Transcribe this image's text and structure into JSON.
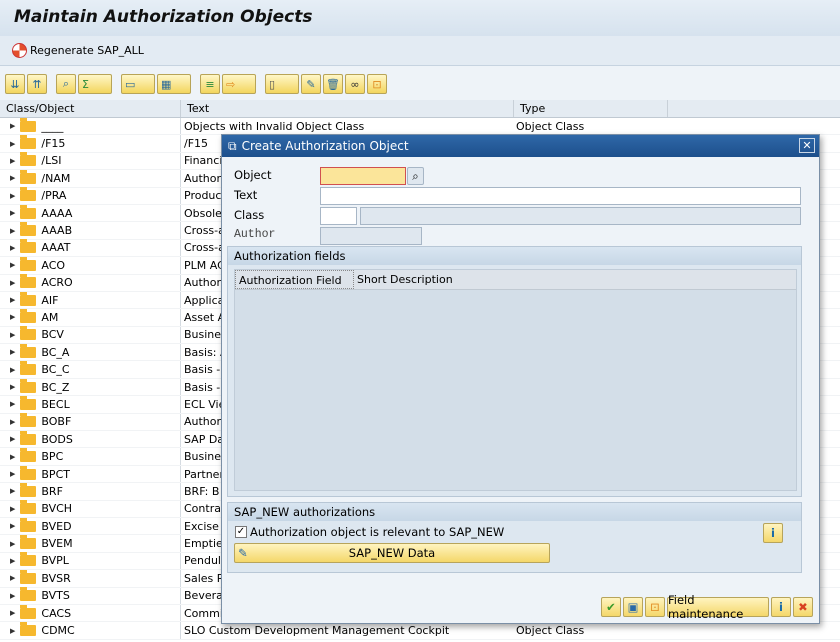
{
  "title": "Maintain Authorization Objects",
  "app_toolbar": {
    "regenerate_label": "Regenerate SAP_ALL"
  },
  "toolbar_icons": [
    "expand-all-icon",
    "collapse-all-icon",
    "find-icon",
    "sum-icon",
    "print-icon",
    "layout-icon",
    "sort-icon",
    "export-icon",
    "new-document-icon",
    "edit-icon",
    "delete-icon",
    "where-used-icon",
    "authorization-icon"
  ],
  "columns": [
    "Class/Object",
    "Text",
    "Type"
  ],
  "rows": [
    {
      "name": "____",
      "text": "Objects with Invalid Object Class",
      "type": "Object Class"
    },
    {
      "name": "/F15",
      "text": "/F15",
      "type": ""
    },
    {
      "name": "/LSI",
      "text": "Financia",
      "type": ""
    },
    {
      "name": "/NAM",
      "text": "Authori",
      "type": ""
    },
    {
      "name": "/PRA",
      "text": "Product",
      "type": ""
    },
    {
      "name": "AAAA",
      "text": "Obsolet",
      "type": ""
    },
    {
      "name": "AAAB",
      "text": "Cross-a",
      "type": ""
    },
    {
      "name": "AAAT",
      "text": "Cross-a",
      "type": ""
    },
    {
      "name": "ACO",
      "text": "PLM AC",
      "type": ""
    },
    {
      "name": "ACRO",
      "text": "Authori",
      "type": ""
    },
    {
      "name": "AIF",
      "text": "Applicat",
      "type": ""
    },
    {
      "name": "AM",
      "text": "Asset A",
      "type": ""
    },
    {
      "name": "BCV",
      "text": "Busines",
      "type": ""
    },
    {
      "name": "BC_A",
      "text": "Basis: A",
      "type": ""
    },
    {
      "name": "BC_C",
      "text": "Basis -",
      "type": ""
    },
    {
      "name": "BC_Z",
      "text": "Basis -",
      "type": ""
    },
    {
      "name": "BECL",
      "text": "ECL Vie",
      "type": ""
    },
    {
      "name": "BOBF",
      "text": "Authori",
      "type": ""
    },
    {
      "name": "BODS",
      "text": "SAP Da",
      "type": ""
    },
    {
      "name": "BPC",
      "text": "Busines",
      "type": ""
    },
    {
      "name": "BPCT",
      "text": "Partner",
      "type": ""
    },
    {
      "name": "BRF",
      "text": "BRF: B",
      "type": ""
    },
    {
      "name": "BVCH",
      "text": "Contrac",
      "type": ""
    },
    {
      "name": "BVED",
      "text": "Excise",
      "type": ""
    },
    {
      "name": "BVEM",
      "text": "Empties",
      "type": ""
    },
    {
      "name": "BVPL",
      "text": "Pendulu",
      "type": ""
    },
    {
      "name": "BVSR",
      "text": "Sales R",
      "type": ""
    },
    {
      "name": "BVTS",
      "text": "Bevera",
      "type": ""
    },
    {
      "name": "CACS",
      "text": "Commi",
      "type": ""
    },
    {
      "name": "CDMC",
      "text": "SLO Custom Development Management Cockpit",
      "type": "Object Class"
    }
  ],
  "dialog": {
    "title": "Create Authorization Object",
    "object_label": "Object",
    "object_value": "",
    "text_label": "Text",
    "text_value": "",
    "class_label": "Class",
    "class_value": "",
    "class_desc": "",
    "author_label": "Author",
    "author_value": "",
    "fields_group": "Authorization fields",
    "fields_columns": [
      "Authorization Field",
      "Short Description"
    ],
    "sapnew_group": "SAP_NEW authorizations",
    "sapnew_checkbox": "Authorization object is relevant to SAP_NEW",
    "sapnew_checked": true,
    "sapnew_button": "SAP_NEW Data",
    "field_maintenance": "Field maintenance",
    "close": "✕"
  },
  "colors": {
    "accent": "#1d4f8c",
    "button": "#f4d76a",
    "required": "#fbe59a"
  }
}
